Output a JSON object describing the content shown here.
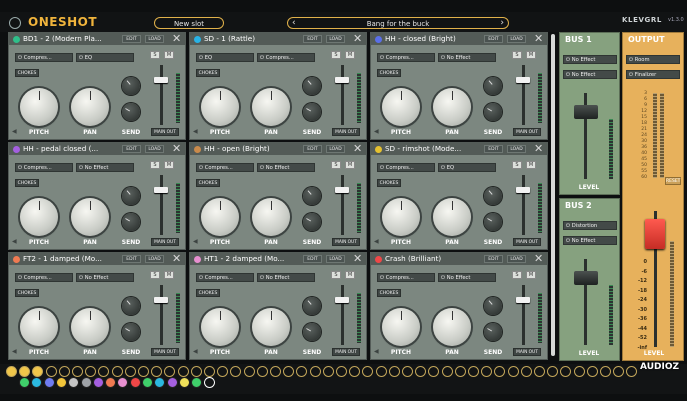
{
  "header": {
    "logo": "ONESHOT",
    "new_slot": "New slot",
    "preset_name": "Bang for the buck",
    "prev_arrow": "‹",
    "next_arrow": "›",
    "brand": "KLEVGRL",
    "version": "v1.3.0"
  },
  "common": {
    "edit": "EDIT",
    "load": "LOAD",
    "chokes": "CHOKES",
    "pitch": "PITCH",
    "pan": "PAN",
    "send": "SEND",
    "main_out": "MAIN OUT",
    "solo": "S",
    "mute": "M",
    "close": "✕",
    "power": "⏻"
  },
  "slots": [
    {
      "name": "BD1 - 2 (Modern Pla...",
      "color": "#2fbf8a",
      "fx1": "Compres...",
      "fx2": "EQ"
    },
    {
      "name": "SD - 1 (Rattle)",
      "color": "#28b3e6",
      "fx1": "EQ",
      "fx2": "Compres..."
    },
    {
      "name": "HH - closed (Bright)",
      "color": "#5a6fe8",
      "fx1": "Compres...",
      "fx2": "No Effect"
    },
    {
      "name": "HH - pedal closed (...",
      "color": "#a45fe0",
      "fx1": "Compres...",
      "fx2": "No Effect"
    },
    {
      "name": "HH - open (Bright)",
      "color": "#c98a4b",
      "fx1": "Compres...",
      "fx2": "No Effect"
    },
    {
      "name": "SD - rimshot (Mode...",
      "color": "#e5c12f",
      "fx1": "Compres...",
      "fx2": "EQ"
    },
    {
      "name": "FT2 - 1 damped (Mo...",
      "color": "#f07a52",
      "fx1": "Compres...",
      "fx2": "No Effect"
    },
    {
      "name": "HT1 - 2 damped (Mo...",
      "color": "#e78fcf",
      "fx1": "Compres...",
      "fx2": "No Effect"
    },
    {
      "name": "Crash (Brilliant)",
      "color": "#ef4747",
      "fx1": "Compres...",
      "fx2": "No Effect"
    }
  ],
  "bus1": {
    "title": "BUS 1",
    "fx1": "No Effect",
    "fx2": "No Effect",
    "level_label": "LEVEL"
  },
  "bus2": {
    "title": "BUS 2",
    "fx1": "Distortion",
    "fx2": "No Effect",
    "level_label": "LEVEL"
  },
  "output": {
    "title": "OUTPUT",
    "fx1": "Room",
    "fx2": "Finalizer",
    "reset": "RESET",
    "level_label": "LEVEL",
    "scale_top": [
      "3",
      "6",
      "9",
      "12",
      "15",
      "18",
      "21",
      "24",
      "30",
      "36",
      "40",
      "45",
      "50",
      "55",
      "60"
    ],
    "scale_bottom": [
      "0",
      "-6",
      "-12",
      "-18",
      "-24",
      "-30",
      "-36",
      "-44",
      "-52",
      "-inf"
    ]
  },
  "pads_colors": [
    "#3fcf6a",
    "#2bb8e0",
    "#6f7cf0",
    "#f2c53a",
    "#c5c5c5",
    "#9fa3a8",
    "#a45fe0",
    "#f07a52",
    "#e78fcf",
    "#ef4747",
    "#3fcf6a",
    "#2bb8e0",
    "#a45fe0",
    "#efe05a",
    "#3fcf6a",
    "#2bb8e0",
    "#c98a4b",
    "#ef4747",
    "#e5c12f",
    "#3fcf6a",
    "#2bb8e0",
    "#a45fe0"
  ],
  "watermark": "AUDIOZ"
}
